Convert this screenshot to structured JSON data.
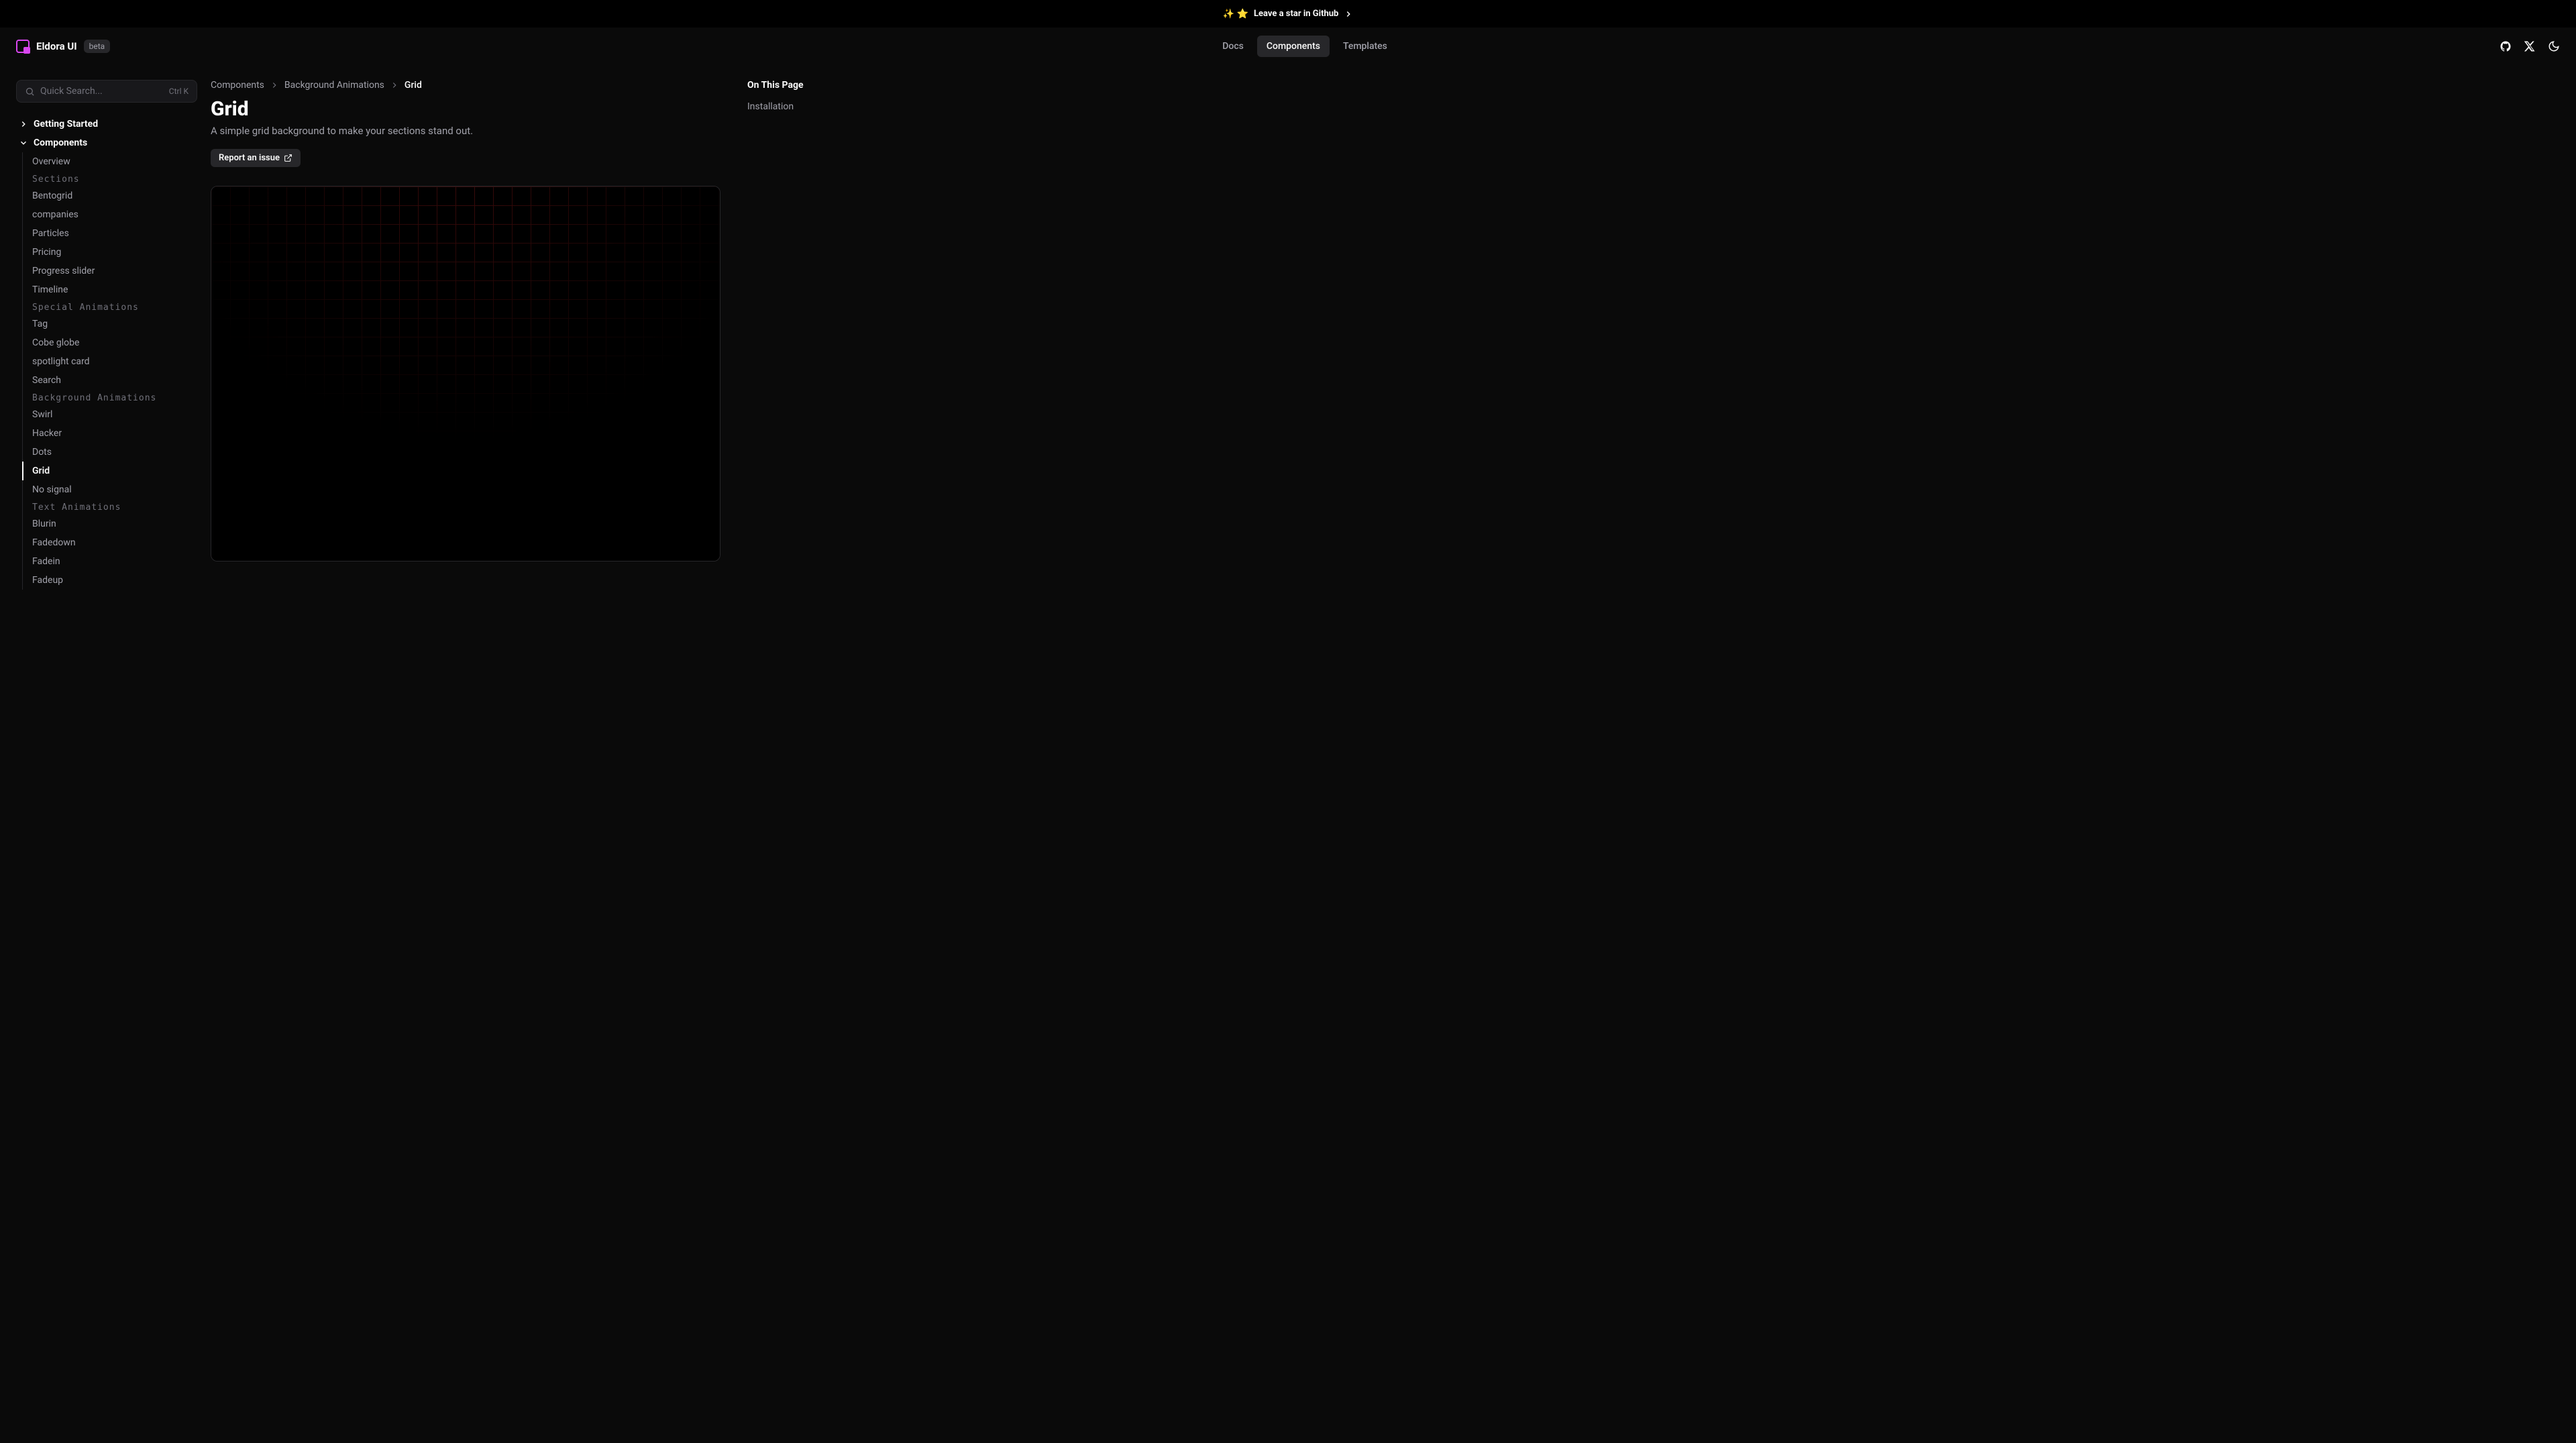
{
  "banner": {
    "emoji": "✨ ⭐",
    "text": "Leave a star in Github"
  },
  "brand": {
    "name": "Eldora UI",
    "badge": "beta"
  },
  "nav": {
    "items": [
      {
        "label": "Docs",
        "active": false
      },
      {
        "label": "Components",
        "active": true
      },
      {
        "label": "Templates",
        "active": false
      }
    ]
  },
  "search": {
    "placeholder": "Quick Search...",
    "kbd": "Ctrl K"
  },
  "sidebar": {
    "sections": [
      {
        "label": "Getting Started",
        "open": false
      },
      {
        "label": "Components",
        "open": true
      }
    ],
    "components": {
      "top": [
        {
          "label": "Overview"
        }
      ],
      "groups": [
        {
          "title": "Sections",
          "items": [
            {
              "label": "Bentogrid"
            },
            {
              "label": "companies"
            },
            {
              "label": "Particles"
            },
            {
              "label": "Pricing"
            },
            {
              "label": "Progress slider"
            },
            {
              "label": "Timeline"
            }
          ]
        },
        {
          "title": "Special Animations",
          "items": [
            {
              "label": "Tag"
            },
            {
              "label": "Cobe globe"
            },
            {
              "label": "spotlight card"
            },
            {
              "label": "Search"
            }
          ]
        },
        {
          "title": "Background Animations",
          "items": [
            {
              "label": "Swirl"
            },
            {
              "label": "Hacker"
            },
            {
              "label": "Dots"
            },
            {
              "label": "Grid",
              "active": true
            },
            {
              "label": "No signal"
            }
          ]
        },
        {
          "title": "Text Animations",
          "items": [
            {
              "label": "Blurin"
            },
            {
              "label": "Fadedown"
            },
            {
              "label": "Fadein"
            },
            {
              "label": "Fadeup"
            }
          ]
        }
      ]
    }
  },
  "breadcrumb": {
    "items": [
      {
        "label": "Components"
      },
      {
        "label": "Background Animations"
      },
      {
        "label": "Grid",
        "active": true
      }
    ]
  },
  "page": {
    "title": "Grid",
    "description": "A simple grid background to make your sections stand out.",
    "report_label": "Report an issue"
  },
  "toc": {
    "title": "On This Page",
    "items": [
      {
        "label": "Installation"
      }
    ]
  }
}
